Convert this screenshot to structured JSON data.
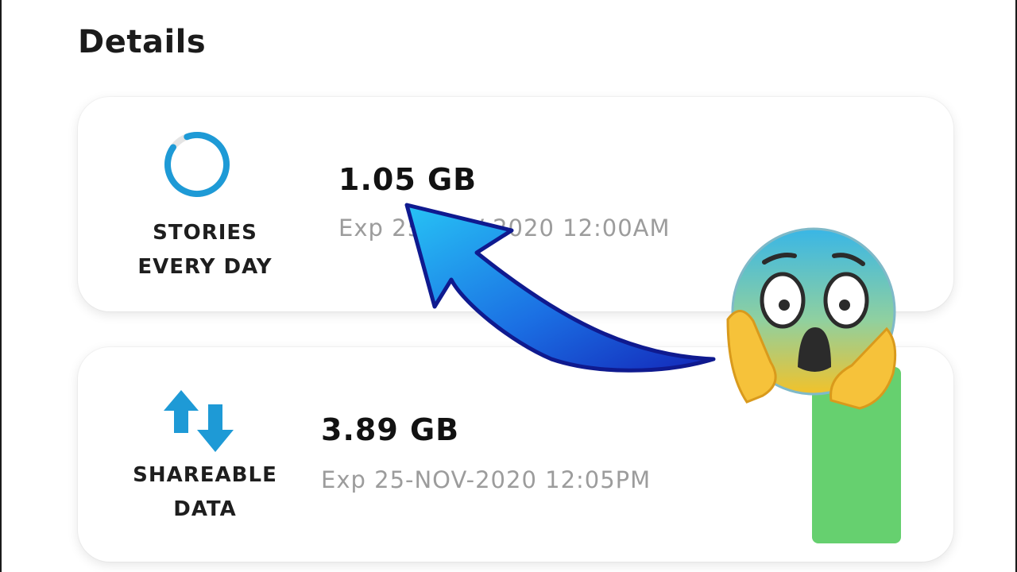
{
  "page": {
    "heading": "Details"
  },
  "cards": [
    {
      "icon": "progress-ring-icon",
      "caption_line1": "STORIES",
      "caption_line2": "EVERY DAY",
      "amount": "1.05 GB",
      "expiry": "Exp 25-NOV-2020 12:00AM"
    },
    {
      "icon": "data-transfer-arrows-icon",
      "caption_line1": "SHAREABLE",
      "caption_line2": "DATA",
      "amount": "3.89 GB",
      "expiry": "Exp 25-NOV-2020 12:05PM"
    }
  ],
  "overlay": {
    "arrow_icon": "curved-arrow-icon",
    "emoji_icon": "fearful-face-emoji-icon",
    "bar_color": "#66d06f"
  },
  "colors": {
    "accent_blue": "#1e9ad6",
    "ring_track": "#e4e4e4",
    "text_primary": "#121212",
    "text_muted": "#9c9c9c"
  }
}
